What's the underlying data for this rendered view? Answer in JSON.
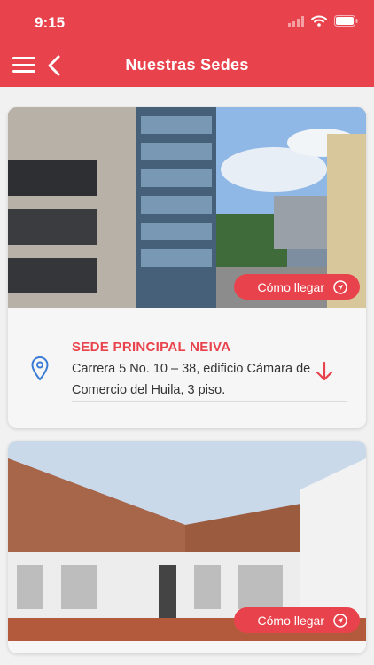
{
  "status": {
    "time": "9:15"
  },
  "header": {
    "title": "Nuestras Sedes"
  },
  "sedes": [
    {
      "route_label": "Cómo llegar",
      "title": "SEDE PRINCIPAL NEIVA",
      "address": "Carrera 5 No. 10 – 38, edificio Cámara de Comercio del Huila, 3 piso."
    },
    {
      "route_label": "Cómo llegar"
    }
  ],
  "colors": {
    "accent": "#e8434c",
    "pin": "#3a7bd5"
  },
  "icons": [
    "menu-icon",
    "back-chevron-icon",
    "navigation-icon",
    "location-pin-icon",
    "arrow-down-icon",
    "wifi-icon",
    "battery-icon",
    "signal-icon"
  ]
}
